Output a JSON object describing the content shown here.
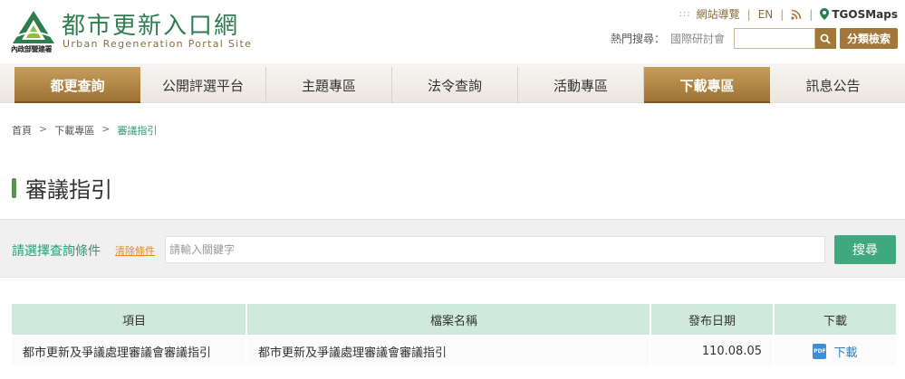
{
  "site": {
    "title": "都市更新入口網",
    "subtitle": "Urban Regeneration Portal Site",
    "agency": "內政部營建署"
  },
  "toplinks": {
    "sitemap": "網站導覽",
    "en": "EN",
    "tgos": "TGOSMaps"
  },
  "hot_search": {
    "label": "熱門搜尋：",
    "item": "國際研討會",
    "input_value": "",
    "category_button": "分類檢索"
  },
  "nav": {
    "items": [
      {
        "label": "都更查詢",
        "active": true
      },
      {
        "label": "公開評選平台",
        "active": false
      },
      {
        "label": "主題專區",
        "active": false
      },
      {
        "label": "法令查詢",
        "active": false
      },
      {
        "label": "活動專區",
        "active": false
      },
      {
        "label": "下載專區",
        "active": true
      },
      {
        "label": "訊息公告",
        "active": false
      }
    ]
  },
  "breadcrumb": {
    "home": "首頁",
    "section": "下載專區",
    "current": "審議指引"
  },
  "page_title": "審議指引",
  "filter": {
    "label": "請選擇查詢條件",
    "clear": "清除條件",
    "placeholder": "請輸入關鍵字",
    "search_button": "搜尋"
  },
  "table": {
    "headers": [
      "項目",
      "檔案名稱",
      "發布日期",
      "下載"
    ],
    "rows": [
      {
        "item": "都市更新及爭議處理審議會審議指引",
        "filename": "都市更新及爭議處理審議會審議指引",
        "date": "110.08.05",
        "download": "下載",
        "file_icon": "PDF"
      }
    ]
  },
  "colors": {
    "brand_green": "#2e7d4f",
    "accent_gold": "#a1783a",
    "teal": "#3fa87c"
  }
}
